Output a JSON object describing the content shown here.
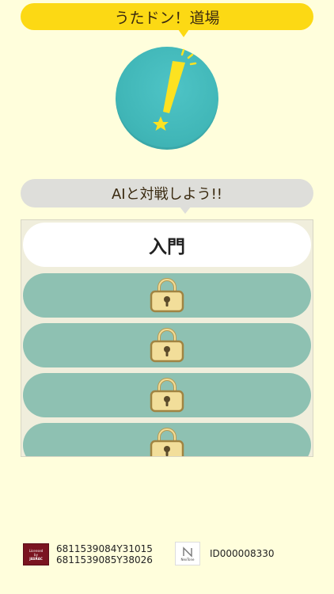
{
  "header": {
    "title": "うたドン！道場"
  },
  "logo": {
    "icon": "exclamation-star-icon",
    "color_circle": "#41B7B8",
    "color_mark": "#FCE221"
  },
  "prompt": {
    "text": "AIと対戦しよう!!"
  },
  "levels": [
    {
      "label": "入門",
      "locked": false
    },
    {
      "label": "",
      "locked": true,
      "icon": "lock-icon"
    },
    {
      "label": "",
      "locked": true,
      "icon": "lock-icon"
    },
    {
      "label": "",
      "locked": true,
      "icon": "lock-icon"
    },
    {
      "label": "",
      "locked": true,
      "icon": "lock-icon"
    }
  ],
  "footer": {
    "jasrac_badge": {
      "line1": "Licensed",
      "line2": "by",
      "line3": "JASRAC"
    },
    "codes": [
      "6811539084Y31015",
      "6811539085Y38026"
    ],
    "nextone_badge": {
      "text": "NexTone"
    },
    "id": "ID000008330"
  }
}
